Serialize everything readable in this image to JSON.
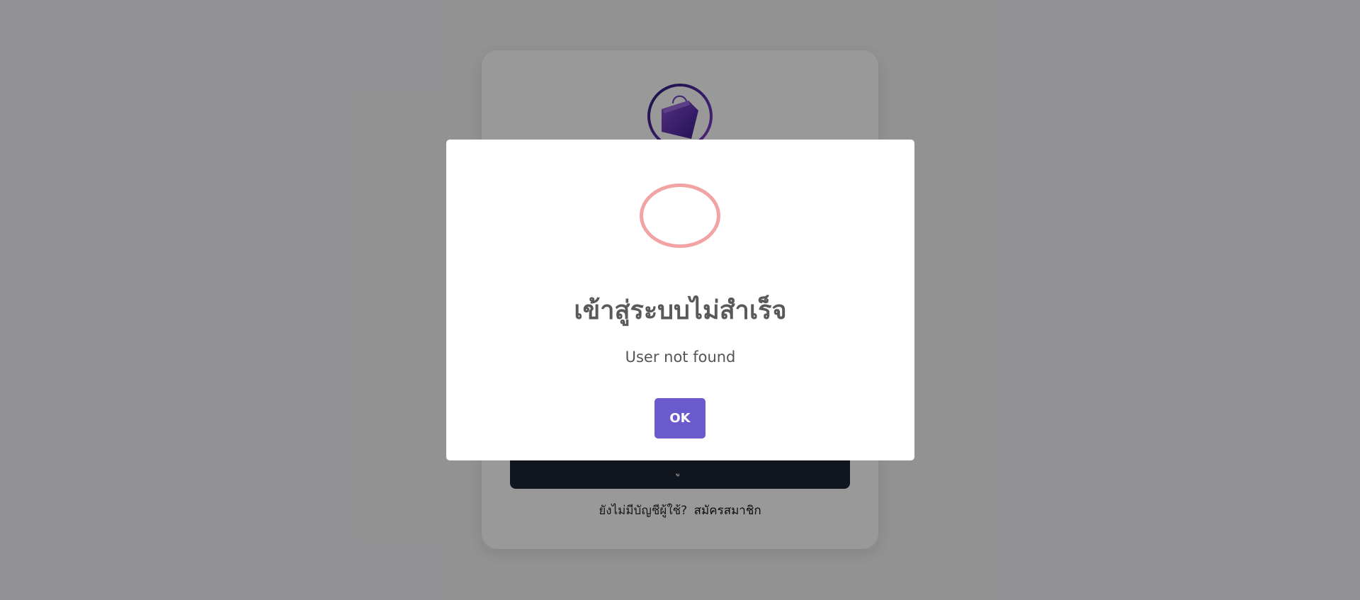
{
  "login": {
    "button_label": "ู",
    "register_prompt": "ยังไม่มีบัญชีผู้ใช้?",
    "register_link": "สมัครสมาชิก"
  },
  "modal": {
    "title": "เข้าสู่ระบบไม่สำเร็จ",
    "text": "User not found",
    "ok_label": "OK",
    "icon": "error-circle-icon"
  },
  "colors": {
    "accent": "#6a5acd",
    "error_ring": "#f2a4a4",
    "login_button": "#1b2433",
    "logo_purple": "#5b2ca8"
  }
}
